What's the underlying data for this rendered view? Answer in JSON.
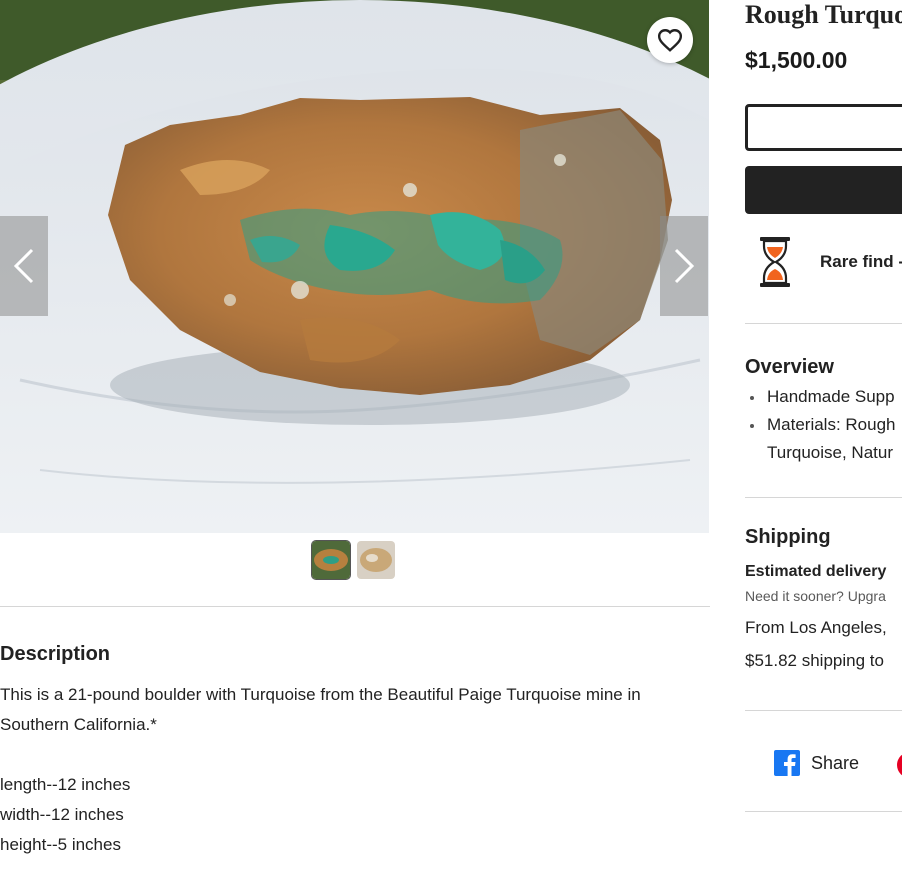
{
  "product": {
    "title": "Rough Turquoi",
    "price": "$1,500.00",
    "rare_find_label": "Rare find -"
  },
  "gallery": {
    "favorite_icon": "heart-icon",
    "prev_icon": "chevron-left-icon",
    "next_icon": "chevron-right-icon",
    "thumbnail_count": 2
  },
  "description": {
    "title": "Description",
    "paragraph": "This is a 21-pound boulder with Turquoise from the Beautiful Paige Turquoise mine in Southern California.*",
    "dimensions": [
      "length--12 inches",
      "width--12 inches",
      "height--5 inches"
    ]
  },
  "overview": {
    "title": "Overview",
    "items": [
      "Handmade Supp",
      "Materials: Rough",
      "Turquoise, Natur"
    ]
  },
  "shipping": {
    "title": "Shipping",
    "estimated_delivery_label": "Estimated delivery",
    "need_sooner": "Need it sooner? Upgra",
    "from": "From Los Angeles,",
    "cost": "$51.82 shipping to"
  },
  "social": {
    "share_label": "Share",
    "share_icon": "facebook-icon",
    "pinterest_icon": "pinterest-icon"
  },
  "colors": {
    "text": "#222222",
    "muted": "#595959",
    "divider": "#d6d6d6",
    "button_dark": "#222222",
    "hourglass_sand": "#f1641e",
    "facebook_blue": "#1877f2",
    "pinterest_red": "#e60023"
  }
}
